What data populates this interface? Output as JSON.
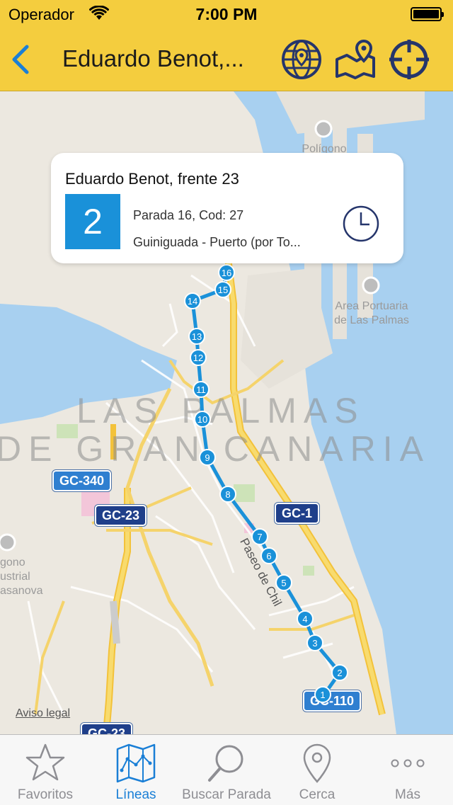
{
  "status_bar": {
    "carrier": "Operador",
    "time": "7:00 PM"
  },
  "nav": {
    "title": "Eduardo Benot,...",
    "icons": [
      "globe-pin-icon",
      "map-pin-icon",
      "crosshair-icon"
    ]
  },
  "callout": {
    "stop_name": "Eduardo Benot, frente 23",
    "line_number": "2",
    "stop_info": "Parada 16, Cod: 27",
    "route": "Guiniguada - Puerto (por To...",
    "line_color": "#1a91d9"
  },
  "map": {
    "city_label_1": "LAS PALMAS",
    "city_label_2": "DE GRAN CANARIA",
    "poi_industrial": "Polígono\nIndustrial\nEl Sebadal",
    "poi_port": "Area Portuaria\nde Las Palmas",
    "poi_left": "gono\nustrial\nasanova",
    "street": "Paseo de Chil",
    "legal": "Aviso legal",
    "shields": {
      "gc340": "GC-340",
      "gc23_top": "GC-23",
      "gc1": "GC-1",
      "gc110": "GC-110",
      "gc23_bottom": "GC-23"
    },
    "route_color": "#1a91d9",
    "stops": [
      "1",
      "2",
      "3",
      "4",
      "5",
      "6",
      "7",
      "8",
      "9",
      "10",
      "11",
      "12",
      "13",
      "14",
      "15",
      "16"
    ]
  },
  "tabs": [
    {
      "label": "Favoritos",
      "icon": "star-icon",
      "active": false
    },
    {
      "label": "Líneas",
      "icon": "route-map-icon",
      "active": true
    },
    {
      "label": "Buscar Parada",
      "icon": "search-icon",
      "active": false
    },
    {
      "label": "Cerca",
      "icon": "location-pin-icon",
      "active": false
    },
    {
      "label": "Más",
      "icon": "more-icon",
      "active": false
    }
  ]
}
